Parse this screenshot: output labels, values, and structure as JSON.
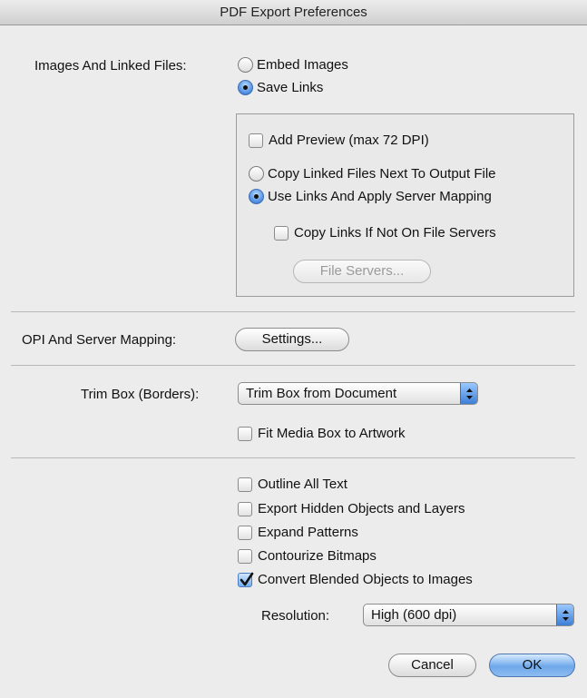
{
  "window": {
    "title": "PDF Export Preferences"
  },
  "images": {
    "label": "Images And Linked Files:",
    "embed_label": "Embed Images",
    "embed_selected": false,
    "save_links_label": "Save Links",
    "save_links_selected": true,
    "add_preview_label": "Add Preview (max 72 DPI)",
    "add_preview_checked": false,
    "copy_linked_label": "Copy Linked Files Next To Output File",
    "copy_linked_selected": false,
    "use_links_label": "Use Links And Apply Server Mapping",
    "use_links_selected": true,
    "copy_if_not_label": "Copy Links If Not On File Servers",
    "copy_if_not_checked": false,
    "file_servers_label": "File Servers..."
  },
  "opi": {
    "label": "OPI And Server Mapping:",
    "settings_label": "Settings..."
  },
  "trim": {
    "label": "Trim Box (Borders):",
    "selected": "Trim Box from Document",
    "fit_media_label": "Fit Media Box to Artwork",
    "fit_media_checked": false
  },
  "options": {
    "outline_text": {
      "label": "Outline All Text",
      "checked": false
    },
    "export_hidden": {
      "label": "Export Hidden Objects and Layers",
      "checked": false
    },
    "expand_patterns": {
      "label": "Expand Patterns",
      "checked": false
    },
    "contourize": {
      "label": "Contourize Bitmaps",
      "checked": false
    },
    "convert_blended": {
      "label": "Convert Blended Objects to Images",
      "checked": true
    }
  },
  "resolution": {
    "label": "Resolution:",
    "selected": "High (600 dpi)"
  },
  "buttons": {
    "cancel_label": "Cancel",
    "ok_label": "OK"
  },
  "colors": {
    "accent": "#4b8be0",
    "window_bg": "#ececec"
  }
}
